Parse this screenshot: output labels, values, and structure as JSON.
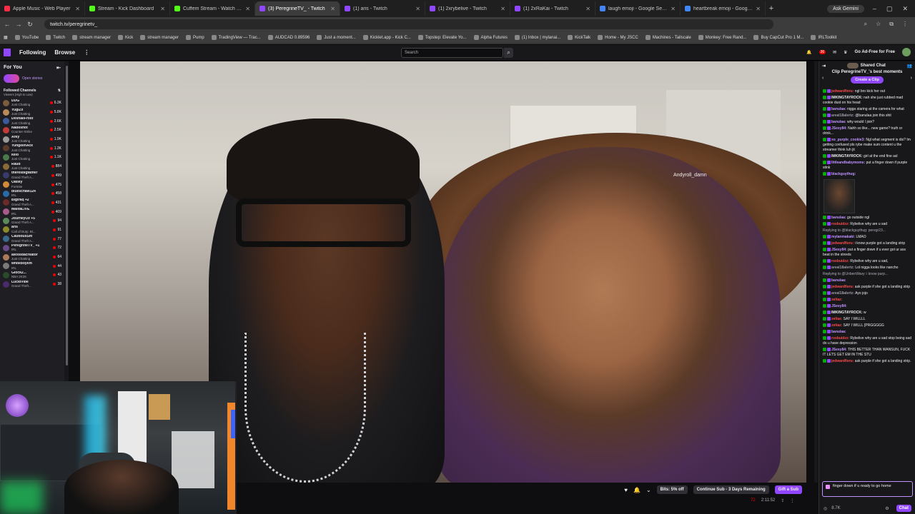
{
  "browser": {
    "tabs": [
      {
        "title": "Apple Music - Web Player",
        "color": "#fa2d48"
      },
      {
        "title": "Stream - Kick Dashboard",
        "color": "#53fc18"
      },
      {
        "title": "Cuffem Stream - Watch Live on",
        "color": "#53fc18"
      },
      {
        "title": "(3) PeregrineTV_ - Twitch",
        "color": "#9147ff",
        "active": true
      },
      {
        "title": "(1) aris - Twitch",
        "color": "#9147ff"
      },
      {
        "title": "(1) 2xrybelive - Twitch",
        "color": "#9147ff"
      },
      {
        "title": "(1) 2xRaKai - Twitch",
        "color": "#9147ff"
      },
      {
        "title": "laugh emoji - Google Search",
        "color": "#4285f4"
      },
      {
        "title": "heartbreak emoji - Google Se",
        "color": "#4285f4"
      }
    ],
    "gemini_label": "Ask Gemini",
    "url": "twitch.tv/peregrinetv_",
    "bookmarks": [
      "YouTube",
      "Twitch",
      "stream manager",
      "Kick",
      "stream manager",
      "Pump",
      "TradingView — Trac...",
      "AUDCAD 0.89596",
      "Just a moment...",
      "Kicklet.app - Kick C...",
      "Topstep: Elevate Yo...",
      "Alpha Futures",
      "(1) Inbox | mylanai...",
      "KickTalk",
      "Home - My JSCC",
      "Machines - Tailscale",
      "Monkey: Free Rand...",
      "Buy CapCut Pro 1 M...",
      "IRLToolkit"
    ]
  },
  "twitch": {
    "following": "Following",
    "browse": "Browse",
    "search_placeholder": "Search",
    "notif_count": "36",
    "ad_free": "Go Ad-Free for Free"
  },
  "sidebar": {
    "for_you": "For You",
    "open_stories": "Open stories",
    "followed_title": "Followed Channels",
    "followed_sort": "Viewers (High to Low)",
    "channels": [
      {
        "name": "DDG",
        "cat": "Just Chatting",
        "viewers": "6.3K",
        "color": "#7a5c3e"
      },
      {
        "name": "YugiZx",
        "cat": "Just Chatting",
        "viewers": "5.8K",
        "color": "#b98a5a"
      },
      {
        "name": "DeshaeFrost",
        "cat": "Just Chatting",
        "viewers": "2.6K",
        "color": "#3c5a9a"
      },
      {
        "name": "Nadeshot",
        "cat": "Counter-Strike",
        "viewers": "2.5K",
        "color": "#c23b3b"
      },
      {
        "name": "Arky",
        "cat": "Just Chatting",
        "viewers": "1.9K",
        "color": "#9a9a9a"
      },
      {
        "name": "YungeenAce",
        "cat": "Just Chatting",
        "viewers": "1.3K",
        "color": "#5a3a2a"
      },
      {
        "name": "kelo",
        "cat": "Just Chatting",
        "viewers": "1.1K",
        "color": "#4a7a4a"
      },
      {
        "name": "Raud",
        "cat": "Just Chatting",
        "viewers": "884",
        "color": "#8a6a3a"
      },
      {
        "name": "theresbigfather",
        "cat": "Grand Theft A...",
        "viewers": "499",
        "color": "#3a3a6a"
      },
      {
        "name": "Oatley",
        "cat": "Fortnite",
        "viewers": "475",
        "color": "#d08a3a"
      },
      {
        "name": "blueschaw124",
        "cat": "IRL",
        "viewers": "458",
        "color": "#2a6aaa"
      },
      {
        "name": "Bigtraq +2",
        "cat": "Grand Theft A...",
        "viewers": "431",
        "color": "#6a2a2a"
      },
      {
        "name": "MalitaLIVE",
        "cat": "IRL",
        "viewers": "409",
        "color": "#aa5a8a"
      },
      {
        "name": "JourneyOz +5",
        "cat": "Grand Theft A...",
        "viewers": "94",
        "color": "#5a8a5a"
      },
      {
        "name": "aris",
        "cat": "Call of Duty: Bl...",
        "viewers": "91",
        "color": "#8a8a2a"
      },
      {
        "name": "CautiousSm",
        "cat": "Grand Theft A...",
        "viewers": "77",
        "color": "#3a6a8a"
      },
      {
        "name": "PeregrineTV_ +1",
        "cat": "IRL",
        "viewers": "72",
        "color": "#6a4a8a"
      },
      {
        "name": "alexisdacreator",
        "cat": "Just Chatting",
        "viewers": "64",
        "color": "#aa7a5a"
      },
      {
        "name": "whiteboyem",
        "cat": "IRL",
        "viewers": "44",
        "color": "#7a7a7a"
      },
      {
        "name": "Glock2...",
        "cat": "NBA 2K26",
        "viewers": "43",
        "color": "#2a4a2a"
      },
      {
        "name": "LucidVibe",
        "cat": "Grand Theft...",
        "viewers": "38",
        "color": "#4a2a6a"
      }
    ]
  },
  "video": {
    "overlay_name": "Andyroll_damn",
    "gift_label": "Gift a Sub",
    "bits_label": "Bits: 5% off",
    "continue_label": "Continue Sub - 3 Days Remaining",
    "viewers": "72",
    "uptime": "2:11:52"
  },
  "chat": {
    "header": "Shared Chat",
    "clip_title": "Clip PeregrineTV_'s best moments",
    "clip_button": "Create a Clip",
    "messages": [
      {
        "user": "jedwardfieru:",
        "text": "ngl bro kick her out",
        "ucolor": "#ff4a4a"
      },
      {
        "user": "IMKINGTAYROCK:",
        "text": "nah she just rubbed mad cookie dust on his head",
        "ucolor": "#efeff1"
      },
      {
        "user": "banulaa:",
        "text": "nigga staring at the camera for what",
        "ucolor": "#bf94ff"
      },
      {
        "user": "areal18alertz:",
        "text": "@banulaa join this shit",
        "ucolor": "#9c9ca8"
      },
      {
        "user": "banulaa:",
        "text": "why would I join?",
        "ucolor": "#bf94ff"
      },
      {
        "user": "JSexy84:",
        "text": "Nahh so like... new game? truth or drink...",
        "ucolor": "#bf94ff"
      },
      {
        "user": "xo_purple_cookie3:",
        "text": "Ngl what segment is dis? Im getting confused pls rybe make sum content u the streamer think luh jit",
        "ucolor": "#bf94ff"
      },
      {
        "user": "IMKINGTAYROCK:",
        "text": "girl at the end fine asl",
        "ucolor": "#efeff1"
      },
      {
        "user": "littleandbabymoms:",
        "text": "put a finger down if purple stink",
        "ucolor": "#bf94ff"
      },
      {
        "user": "blackguythug:",
        "text": "",
        "ucolor": "#bf94ff"
      },
      {
        "user": "banulaa:",
        "text": "go outside ngl",
        "ucolor": "#bf94ff"
      },
      {
        "user": "rosbuidzz:",
        "text": "Rybelive why are u sad",
        "ucolor": "#ff4a4a"
      },
      {
        "reply": "Replying to @blackguythug: peregr23..."
      },
      {
        "user": "mylanmakaki:",
        "text": "LMAO",
        "ucolor": "#bf94ff"
      },
      {
        "user": "jedwardfieru:",
        "text": "i know purple got a landing strip",
        "ucolor": "#ff4a4a"
      },
      {
        "user": "JSexy84:",
        "text": "put a finger down if u ever got ur ass beat in the streets",
        "ucolor": "#bf94ff"
      },
      {
        "user": "rosbuidzz:",
        "text": "Rybelive why are u sad,",
        "ucolor": "#ff4a4a"
      },
      {
        "user": "areal18alertz:",
        "text": "Lol nigga looks like nancho",
        "ucolor": "#9c9ca8"
      },
      {
        "reply": "Replying to @UnbenWavy: i know purp..."
      },
      {
        "user": "banulaa:",
        "text": "",
        "ucolor": "#bf94ff"
      },
      {
        "user": "jedwardfieru:",
        "text": "ask purple if she got a landing strip",
        "ucolor": "#ff4a4a"
      },
      {
        "user": "areal18alertz:",
        "text": "Ayo jojo",
        "ucolor": "#9c9ca8"
      },
      {
        "user": "zeltaz:",
        "text": "",
        "ucolor": "#ff4a4a"
      },
      {
        "user": "JSexy84:",
        "text": "",
        "ucolor": "#bf94ff"
      },
      {
        "user": "IMKINGTAYROCK:",
        "text": "w",
        "ucolor": "#efeff1"
      },
      {
        "user": "zeltaz:",
        "text": "SAY I WILLLL",
        "ucolor": "#ff4a4a"
      },
      {
        "user": "zeltaz:",
        "text": "SAY I WILLL [PRGGGGG",
        "ucolor": "#ff4a4a"
      },
      {
        "user": "banulaa:",
        "text": "",
        "ucolor": "#bf94ff"
      },
      {
        "user": "rosbuidzz:",
        "text": "Rybelive why are u sad stop being sad do u have depression",
        "ucolor": "#ff4a4a"
      },
      {
        "user": "JSexy84:",
        "text": "THIS BETTER THAN WANSUN, FUCK IT LETS GET EM IN THE STU",
        "ucolor": "#bf94ff"
      },
      {
        "user": "jedwardfieru:",
        "text": "ask purple if she got a landing strip.",
        "ucolor": "#ff4a4a"
      }
    ],
    "input_text": "finger down if u ready to go home",
    "points": "8.7K",
    "chat_button": "Chat"
  }
}
